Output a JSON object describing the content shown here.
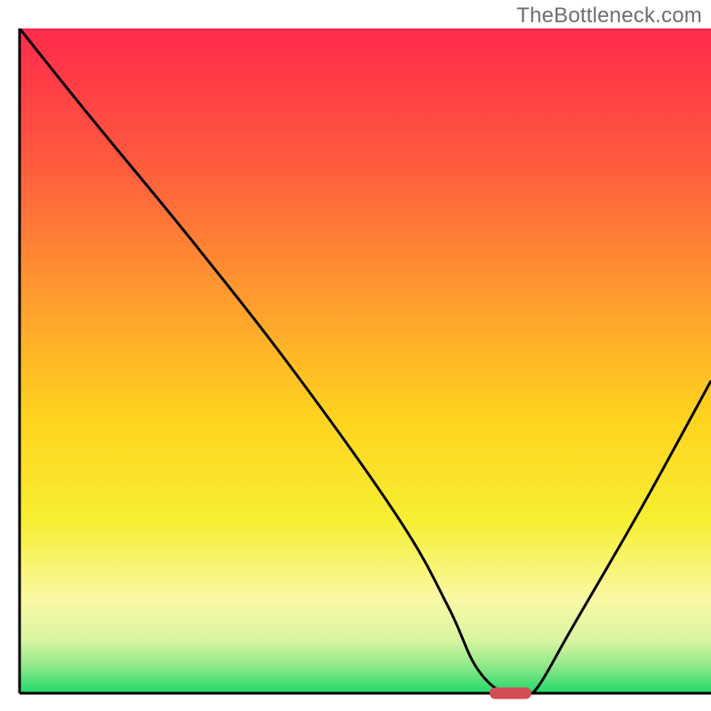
{
  "watermark": "TheBottleneck.com",
  "chart_data": {
    "type": "line",
    "title": "",
    "xlabel": "",
    "ylabel": "",
    "xlim": [
      0,
      100
    ],
    "ylim": [
      0,
      100
    ],
    "grid": false,
    "legend": false,
    "series": [
      {
        "name": "bottleneck-curve",
        "x": [
          0,
          10,
          25,
          40,
          55,
          62,
          66,
          70,
          73,
          75,
          80,
          90,
          100
        ],
        "y": [
          100,
          87,
          68,
          48,
          26,
          13,
          4,
          0,
          0,
          1,
          10,
          28,
          47
        ]
      }
    ],
    "marker": {
      "name": "optimum-marker",
      "x_center": 71,
      "y": 0,
      "width": 6,
      "color": "#d14e52"
    },
    "background_gradient": {
      "type": "vertical",
      "stops": [
        {
          "offset": 0.0,
          "color": "#ff2a4b"
        },
        {
          "offset": 0.2,
          "color": "#ff5a3e"
        },
        {
          "offset": 0.4,
          "color": "#ff9a2f"
        },
        {
          "offset": 0.58,
          "color": "#ffd21f"
        },
        {
          "offset": 0.74,
          "color": "#f7ef32"
        },
        {
          "offset": 0.86,
          "color": "#faf9a5"
        },
        {
          "offset": 0.92,
          "color": "#d9f5a0"
        },
        {
          "offset": 0.96,
          "color": "#8de88a"
        },
        {
          "offset": 1.0,
          "color": "#22d96a"
        }
      ]
    },
    "axis_color": "#000000",
    "curve_color": "#000000",
    "baseline_color": "#000000"
  }
}
